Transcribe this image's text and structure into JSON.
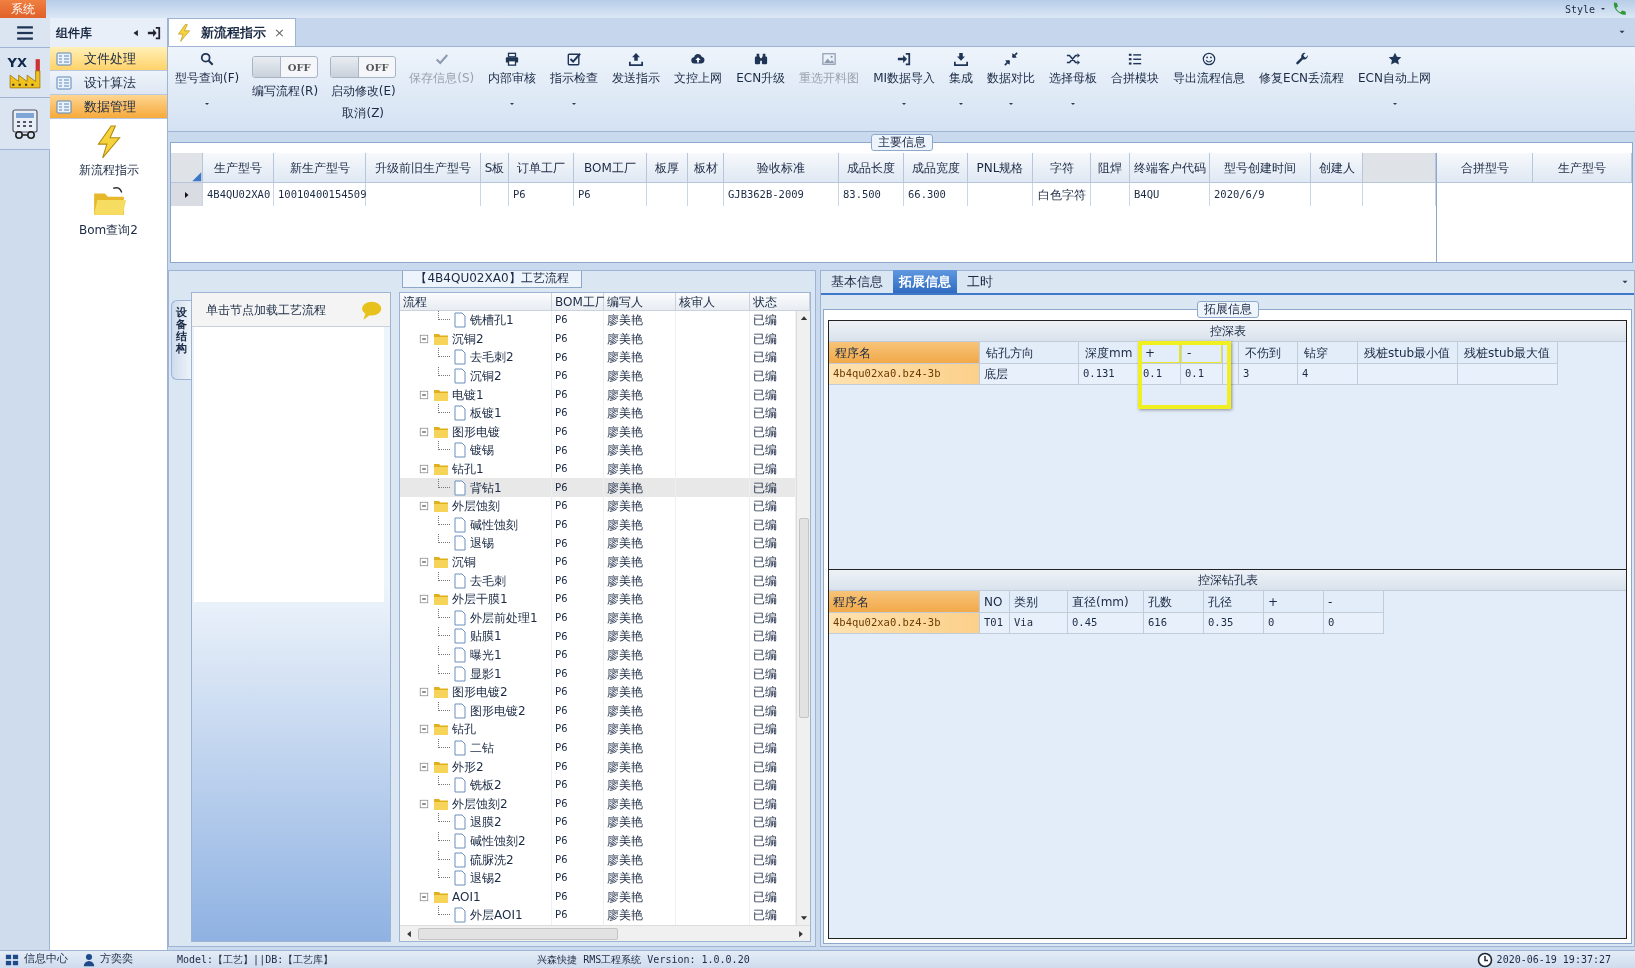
{
  "title_bar": {
    "system_menu": "系统",
    "style_menu": "Style"
  },
  "icon_bar": {
    "logo_text": "YX"
  },
  "component_panel": {
    "title": "组件库",
    "categories": [
      {
        "label": "文件处理",
        "selected": false,
        "hovered": true
      },
      {
        "label": "设计算法",
        "selected": false,
        "hovered": false
      },
      {
        "label": "数据管理",
        "selected": true,
        "hovered": false
      }
    ],
    "items": [
      {
        "label": "新流程指示"
      },
      {
        "label": "Bom查询2"
      }
    ]
  },
  "doc_tabs": [
    {
      "label": "新流程指示",
      "selected": true,
      "close": "×"
    }
  ],
  "toolbar": {
    "items": [
      {
        "kind": "button",
        "label": "型号查询(F)",
        "dropdown": true,
        "disabled": false
      },
      {
        "kind": "toggle",
        "label": "编写流程(R)",
        "state_text": "OFF",
        "on": false
      },
      {
        "kind": "toggle",
        "label": "启动修改(E)",
        "sublabel": "取消(Z)",
        "state_text": "OFF",
        "on": false
      },
      {
        "kind": "button",
        "label": "保存信息(S)",
        "dropdown": false,
        "disabled": true
      },
      {
        "kind": "button",
        "label": "内部审核",
        "dropdown": true,
        "disabled": false
      },
      {
        "kind": "button",
        "label": "指示检查",
        "dropdown": true,
        "disabled": false
      },
      {
        "kind": "button",
        "label": "发送指示",
        "dropdown": false,
        "disabled": false
      },
      {
        "kind": "button",
        "label": "文控上网",
        "dropdown": false,
        "disabled": false
      },
      {
        "kind": "button",
        "label": "ECN升级",
        "dropdown": false,
        "disabled": false
      },
      {
        "kind": "button",
        "label": "重选开料图",
        "dropdown": false,
        "disabled": true
      },
      {
        "kind": "button",
        "label": "MI数据导入",
        "dropdown": true,
        "disabled": false
      },
      {
        "kind": "button",
        "label": "集成",
        "dropdown": true,
        "disabled": false
      },
      {
        "kind": "button",
        "label": "数据对比",
        "dropdown": true,
        "disabled": false
      },
      {
        "kind": "button",
        "label": "选择母板",
        "dropdown": true,
        "disabled": false
      },
      {
        "kind": "button",
        "label": "合拼模块",
        "dropdown": false,
        "disabled": false
      },
      {
        "kind": "button",
        "label": "导出流程信息",
        "dropdown": false,
        "disabled": false
      },
      {
        "kind": "button",
        "label": "修复ECN丢流程",
        "dropdown": false,
        "disabled": false
      },
      {
        "kind": "button",
        "label": "ECN自动上网",
        "dropdown": true,
        "disabled": false
      }
    ]
  },
  "main_info": {
    "title": "主要信息",
    "columns": [
      "生产型号",
      "新生产型号",
      "升级前旧生产型号",
      "S板",
      "订单工厂",
      "BOM工厂",
      "板厚",
      "板材",
      "验收标准",
      "成品长度",
      "成品宽度",
      "PNL规格",
      "字符",
      "阻焊",
      "终端客户代码",
      "型号创建时间",
      "创建人"
    ],
    "rows": [
      {
        "selected": true,
        "cells": [
          "4B4QU02XA0",
          "10010400154509",
          null,
          null,
          "P6",
          "P6",
          null,
          null,
          "GJB362B-2009",
          "83.500",
          "66.300",
          null,
          "白色字符",
          null,
          "B4QU",
          "2020/6/9",
          null
        ]
      }
    ],
    "side_table": {
      "columns": [
        "合拼型号",
        "生产型号"
      ]
    }
  },
  "equipment_panel": {
    "tab": "设备结构",
    "hint": "单击节点加载工艺流程"
  },
  "process_tree": {
    "title": "【4B4QU02XA0】工艺流程",
    "columns": [
      "流程",
      "BOM工厂",
      "编写人",
      "核审人",
      "状态"
    ],
    "rows": [
      {
        "kind": "file",
        "name": "铣槽孔1",
        "bom": "P6",
        "author": "廖美艳",
        "status": "已编",
        "selected": false
      },
      {
        "kind": "folder",
        "name": "沉铜2",
        "bom": "P6",
        "author": "廖美艳",
        "status": "已编",
        "selected": false,
        "expanded": true,
        "children": [
          {
            "kind": "file",
            "name": "去毛刺2",
            "bom": "P6",
            "author": "廖美艳",
            "status": "已编",
            "selected": false
          },
          {
            "kind": "file",
            "name": "沉铜2",
            "bom": "P6",
            "author": "廖美艳",
            "status": "已编",
            "selected": false
          }
        ]
      },
      {
        "kind": "folder",
        "name": "电镀1",
        "bom": "P6",
        "author": "廖美艳",
        "status": "已编",
        "selected": false,
        "expanded": true,
        "children": [
          {
            "kind": "file",
            "name": "板镀1",
            "bom": "P6",
            "author": "廖美艳",
            "status": "已编",
            "selected": false
          }
        ]
      },
      {
        "kind": "folder",
        "name": "图形电镀",
        "bom": "P6",
        "author": "廖美艳",
        "status": "已编",
        "selected": false,
        "expanded": true,
        "children": [
          {
            "kind": "file",
            "name": "镀锡",
            "bom": "P6",
            "author": "廖美艳",
            "status": "已编",
            "selected": false
          }
        ]
      },
      {
        "kind": "folder",
        "name": "钻孔1",
        "bom": "P6",
        "author": "廖美艳",
        "status": "已编",
        "selected": false,
        "expanded": true,
        "children": [
          {
            "kind": "file",
            "name": "背钻1",
            "bom": "P6",
            "author": "廖美艳",
            "status": "已编",
            "selected": true
          }
        ]
      },
      {
        "kind": "folder",
        "name": "外层蚀刻",
        "bom": "P6",
        "author": "廖美艳",
        "status": "已编",
        "selected": false,
        "expanded": true,
        "children": [
          {
            "kind": "file",
            "name": "碱性蚀刻",
            "bom": "P6",
            "author": "廖美艳",
            "status": "已编",
            "selected": false
          },
          {
            "kind": "file",
            "name": "退锡",
            "bom": "P6",
            "author": "廖美艳",
            "status": "已编",
            "selected": false
          }
        ]
      },
      {
        "kind": "folder",
        "name": "沉铜",
        "bom": "P6",
        "author": "廖美艳",
        "status": "已编",
        "selected": false,
        "expanded": true,
        "children": [
          {
            "kind": "file",
            "name": "去毛刺",
            "bom": "P6",
            "author": "廖美艳",
            "status": "已编",
            "selected": false
          }
        ]
      },
      {
        "kind": "folder",
        "name": "外层干膜1",
        "bom": "P6",
        "author": "廖美艳",
        "status": "已编",
        "selected": false,
        "expanded": true,
        "children": [
          {
            "kind": "file",
            "name": "外层前处理1",
            "bom": "P6",
            "author": "廖美艳",
            "status": "已编",
            "selected": false
          },
          {
            "kind": "file",
            "name": "贴膜1",
            "bom": "P6",
            "author": "廖美艳",
            "status": "已编",
            "selected": false
          },
          {
            "kind": "file",
            "name": "曝光1",
            "bom": "P6",
            "author": "廖美艳",
            "status": "已编",
            "selected": false
          },
          {
            "kind": "file",
            "name": "显影1",
            "bom": "P6",
            "author": "廖美艳",
            "status": "已编",
            "selected": false
          }
        ]
      },
      {
        "kind": "folder",
        "name": "图形电镀2",
        "bom": "P6",
        "author": "廖美艳",
        "status": "已编",
        "selected": false,
        "expanded": true,
        "children": [
          {
            "kind": "file",
            "name": "图形电镀2",
            "bom": "P6",
            "author": "廖美艳",
            "status": "已编",
            "selected": false
          }
        ]
      },
      {
        "kind": "folder",
        "name": "钻孔",
        "bom": "P6",
        "author": "廖美艳",
        "status": "已编",
        "selected": false,
        "expanded": true,
        "children": [
          {
            "kind": "file",
            "name": "二钻",
            "bom": "P6",
            "author": "廖美艳",
            "status": "已编",
            "selected": false
          }
        ]
      },
      {
        "kind": "folder",
        "name": "外形2",
        "bom": "P6",
        "author": "廖美艳",
        "status": "已编",
        "selected": false,
        "expanded": true,
        "children": [
          {
            "kind": "file",
            "name": "铣板2",
            "bom": "P6",
            "author": "廖美艳",
            "status": "已编",
            "selected": false
          }
        ]
      },
      {
        "kind": "folder",
        "name": "外层蚀刻2",
        "bom": "P6",
        "author": "廖美艳",
        "status": "已编",
        "selected": false,
        "expanded": true,
        "children": [
          {
            "kind": "file",
            "name": "退膜2",
            "bom": "P6",
            "author": "廖美艳",
            "status": "已编",
            "selected": false
          },
          {
            "kind": "file",
            "name": "碱性蚀刻2",
            "bom": "P6",
            "author": "廖美艳",
            "status": "已编",
            "selected": false
          },
          {
            "kind": "file",
            "name": "硫脲洗2",
            "bom": "P6",
            "author": "廖美艳",
            "status": "已编",
            "selected": false
          },
          {
            "kind": "file",
            "name": "退锡2",
            "bom": "P6",
            "author": "廖美艳",
            "status": "已编",
            "selected": false
          }
        ]
      },
      {
        "kind": "folder",
        "name": "AOI1",
        "bom": "P6",
        "author": "廖美艳",
        "status": "已编",
        "selected": false,
        "expanded": true,
        "children": [
          {
            "kind": "file",
            "name": "外层AOI1",
            "bom": "P6",
            "author": "廖美艳",
            "status": "已编",
            "selected": false
          }
        ]
      }
    ]
  },
  "detail_tabs": [
    {
      "label": "基本信息",
      "selected": false
    },
    {
      "label": "拓展信息",
      "selected": true
    },
    {
      "label": "工时",
      "selected": false
    }
  ],
  "extension": {
    "title": "拓展信息",
    "tables": [
      {
        "title": "控深表",
        "columns": [
          {
            "label": "程序名",
            "highlighted": false
          },
          {
            "label": "钻孔方向",
            "highlighted": false
          },
          {
            "label": "深度mm",
            "highlighted": false
          },
          {
            "label": "+",
            "highlighted": true
          },
          {
            "label": "-",
            "highlighted": true
          },
          {
            "highlighted": false
          },
          {
            "label": "不伤到",
            "highlighted": false
          },
          {
            "label": "钻穿",
            "highlighted": false
          },
          {
            "label": "残桩stub最小值",
            "highlighted": false
          },
          {
            "label": "残桩stub最大值",
            "highlighted": false
          }
        ],
        "rows": [
          [
            "4b4qu02xa0.bz4-3b",
            "底层",
            "0.131",
            "0.1",
            "0.1",
            null,
            "3",
            "4",
            null,
            null
          ]
        ]
      },
      {
        "title": "控深钻孔表",
        "columns": [
          {
            "label": "程序名",
            "highlighted": false
          },
          {
            "label": "NO",
            "highlighted": false
          },
          {
            "label": "类别",
            "highlighted": false
          },
          {
            "label": "直径(mm)",
            "highlighted": false
          },
          {
            "label": "孔数",
            "highlighted": false
          },
          {
            "label": "孔径",
            "highlighted": false
          },
          {
            "label": "+",
            "highlighted": false
          },
          {
            "label": "-",
            "highlighted": false
          }
        ],
        "rows": [
          [
            "4b4qu02xa0.bz4-3b",
            "T01",
            "Via",
            "0.45",
            "616",
            "0.35",
            "0",
            "0"
          ]
        ]
      }
    ]
  },
  "status_bar": {
    "info_center": "信息中心",
    "user": "方奕奕",
    "model": "Model:【工艺】||DB:【工艺库】",
    "version": "兴森快捷 RMS工程系统 Version: 1.0.0.20",
    "datetime": "2020-06-19 19:37:27"
  }
}
